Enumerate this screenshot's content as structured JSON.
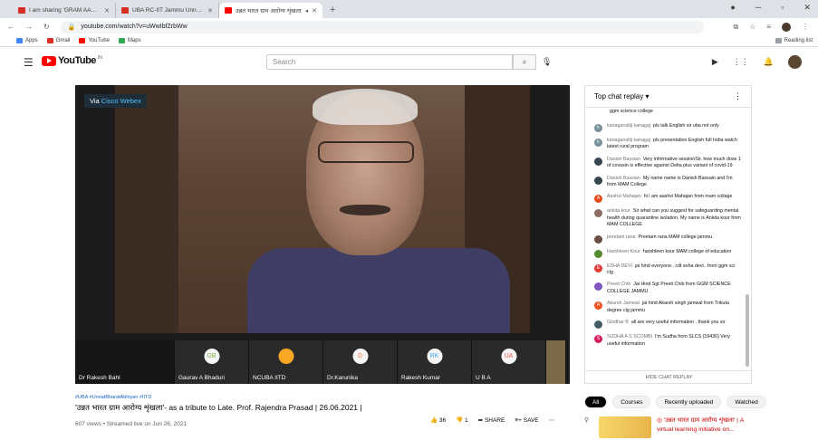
{
  "browser": {
    "tabs": [
      {
        "title": "I am sharing 'GRAM AAROGYA S",
        "favicon_color": "#d93025"
      },
      {
        "title": "UBA RC-IIT Jammu Unnat Bharat",
        "favicon_color": "#d93025"
      },
      {
        "title": "उन्नत भारत ग्राम आरोग्य शृंखला",
        "favicon_color": "#ff0000",
        "active": true
      }
    ],
    "new_tab": "+",
    "url": "youtube.com/watch?v=uWwIbfZrbWw",
    "bookmarks": [
      "Apps",
      "Gmail",
      "YouTube",
      "Maps"
    ],
    "reading_list": "Reading list"
  },
  "youtube": {
    "logo_text": "YouTube",
    "logo_country": "IN",
    "search_placeholder": "Search"
  },
  "video": {
    "overlay": {
      "prefix": "Via ",
      "brand": "Cisco Webex"
    },
    "participants": [
      {
        "initials": "",
        "name": "Dr Rakesh Bahl",
        "color": "#161616"
      },
      {
        "initials": "GB",
        "name": "Gaurav A Bhaduri",
        "color": "#7cb342"
      },
      {
        "initials": "",
        "name": "NCUBA IITD",
        "color": "#f9a825"
      },
      {
        "initials": "D",
        "name": "Dr.Karunika",
        "color": "#ff7043"
      },
      {
        "initials": "RK",
        "name": "Rakesh Kumar",
        "color": "#42a5f5"
      },
      {
        "initials": "UA",
        "name": "U B A",
        "color": "#ef5350"
      }
    ],
    "hashtags": "#UBA #UnnatBharatAbhiyan #IITD",
    "title": "'उन्नत भारत ग्राम आरोग्य शृंखला'- as a tribute to Late. Prof. Rajendra Prasad | 26.06.2021 |",
    "views": "607 views • Streamed live on Jun 26, 2021",
    "likes": "36",
    "dislikes": "1",
    "share": "SHARE",
    "save": "SAVE"
  },
  "chat": {
    "header": "Top chat replay",
    "messages": [
      {
        "author": "",
        "text": "ggm science college",
        "color": "#9e9e9e"
      },
      {
        "author": "kanaganallij kanagaj",
        "text": "pls talk English sir uba not only",
        "color": "#78909c"
      },
      {
        "author": "kanaganallij kanagaj",
        "text": "pls presentation English full India watch latest rural program",
        "color": "#78909c"
      },
      {
        "author": "Danish Bassian",
        "text": "Very informative sessionSir, how much dose 1 of covaxin is effective against Delta plus variant of covid-19",
        "color": "#37474f"
      },
      {
        "author": "Danish Bassian",
        "text": "My name name is Danish Bassain and I'm from MAM College",
        "color": "#37474f"
      },
      {
        "author": "Aashvi Mahajan",
        "text": "hi i am aashvi Mahajan from mam collage",
        "color": "#e64a19"
      },
      {
        "author": "ankita kour",
        "text": "Sir what can you suggest for safeguarding mental health during quarantine isolation. My name is Ankita kour from MAM COLLEGE",
        "color": "#8d6e63"
      },
      {
        "author": "preetam rana",
        "text": "Preetam rana MAM college jammu",
        "color": "#6d4c41"
      },
      {
        "author": "Harshleen Kour",
        "text": "harshleen kour MAM college of education",
        "color": "#558b2f"
      },
      {
        "author": "ESHA DEVI",
        "text": "jai hind everyone.. cdt esha devi.. from ggm sci clg",
        "color": "#e53935"
      },
      {
        "author": "Preeti Chib",
        "text": "Jai Hind Sgt Preeti Chib from GGM SCIENCE COLLEGE JAMMU",
        "color": "#7e57c2"
      },
      {
        "author": "Akarsh Jamwal",
        "text": "jai hind Akarsh singh jamwal from Trikuta degree clg jammu",
        "color": "#f4511e"
      },
      {
        "author": "Giridhar B",
        "text": "all are very useful information . thank you sir",
        "color": "#455a64"
      },
      {
        "author": "SUDHA A S SCOMBI",
        "text": "I'm Sudha from SLCS (19430) Very useful information",
        "color": "#d81b60"
      }
    ],
    "hide_label": "HIDE CHAT REPLAY"
  },
  "chips": [
    "All",
    "Courses",
    "Recently uploaded",
    "Watched"
  ],
  "recommendation": {
    "title": "'उन्नत भारत ग्राम आरोग्य शृंखला' | A virtual learning initiative on..."
  }
}
